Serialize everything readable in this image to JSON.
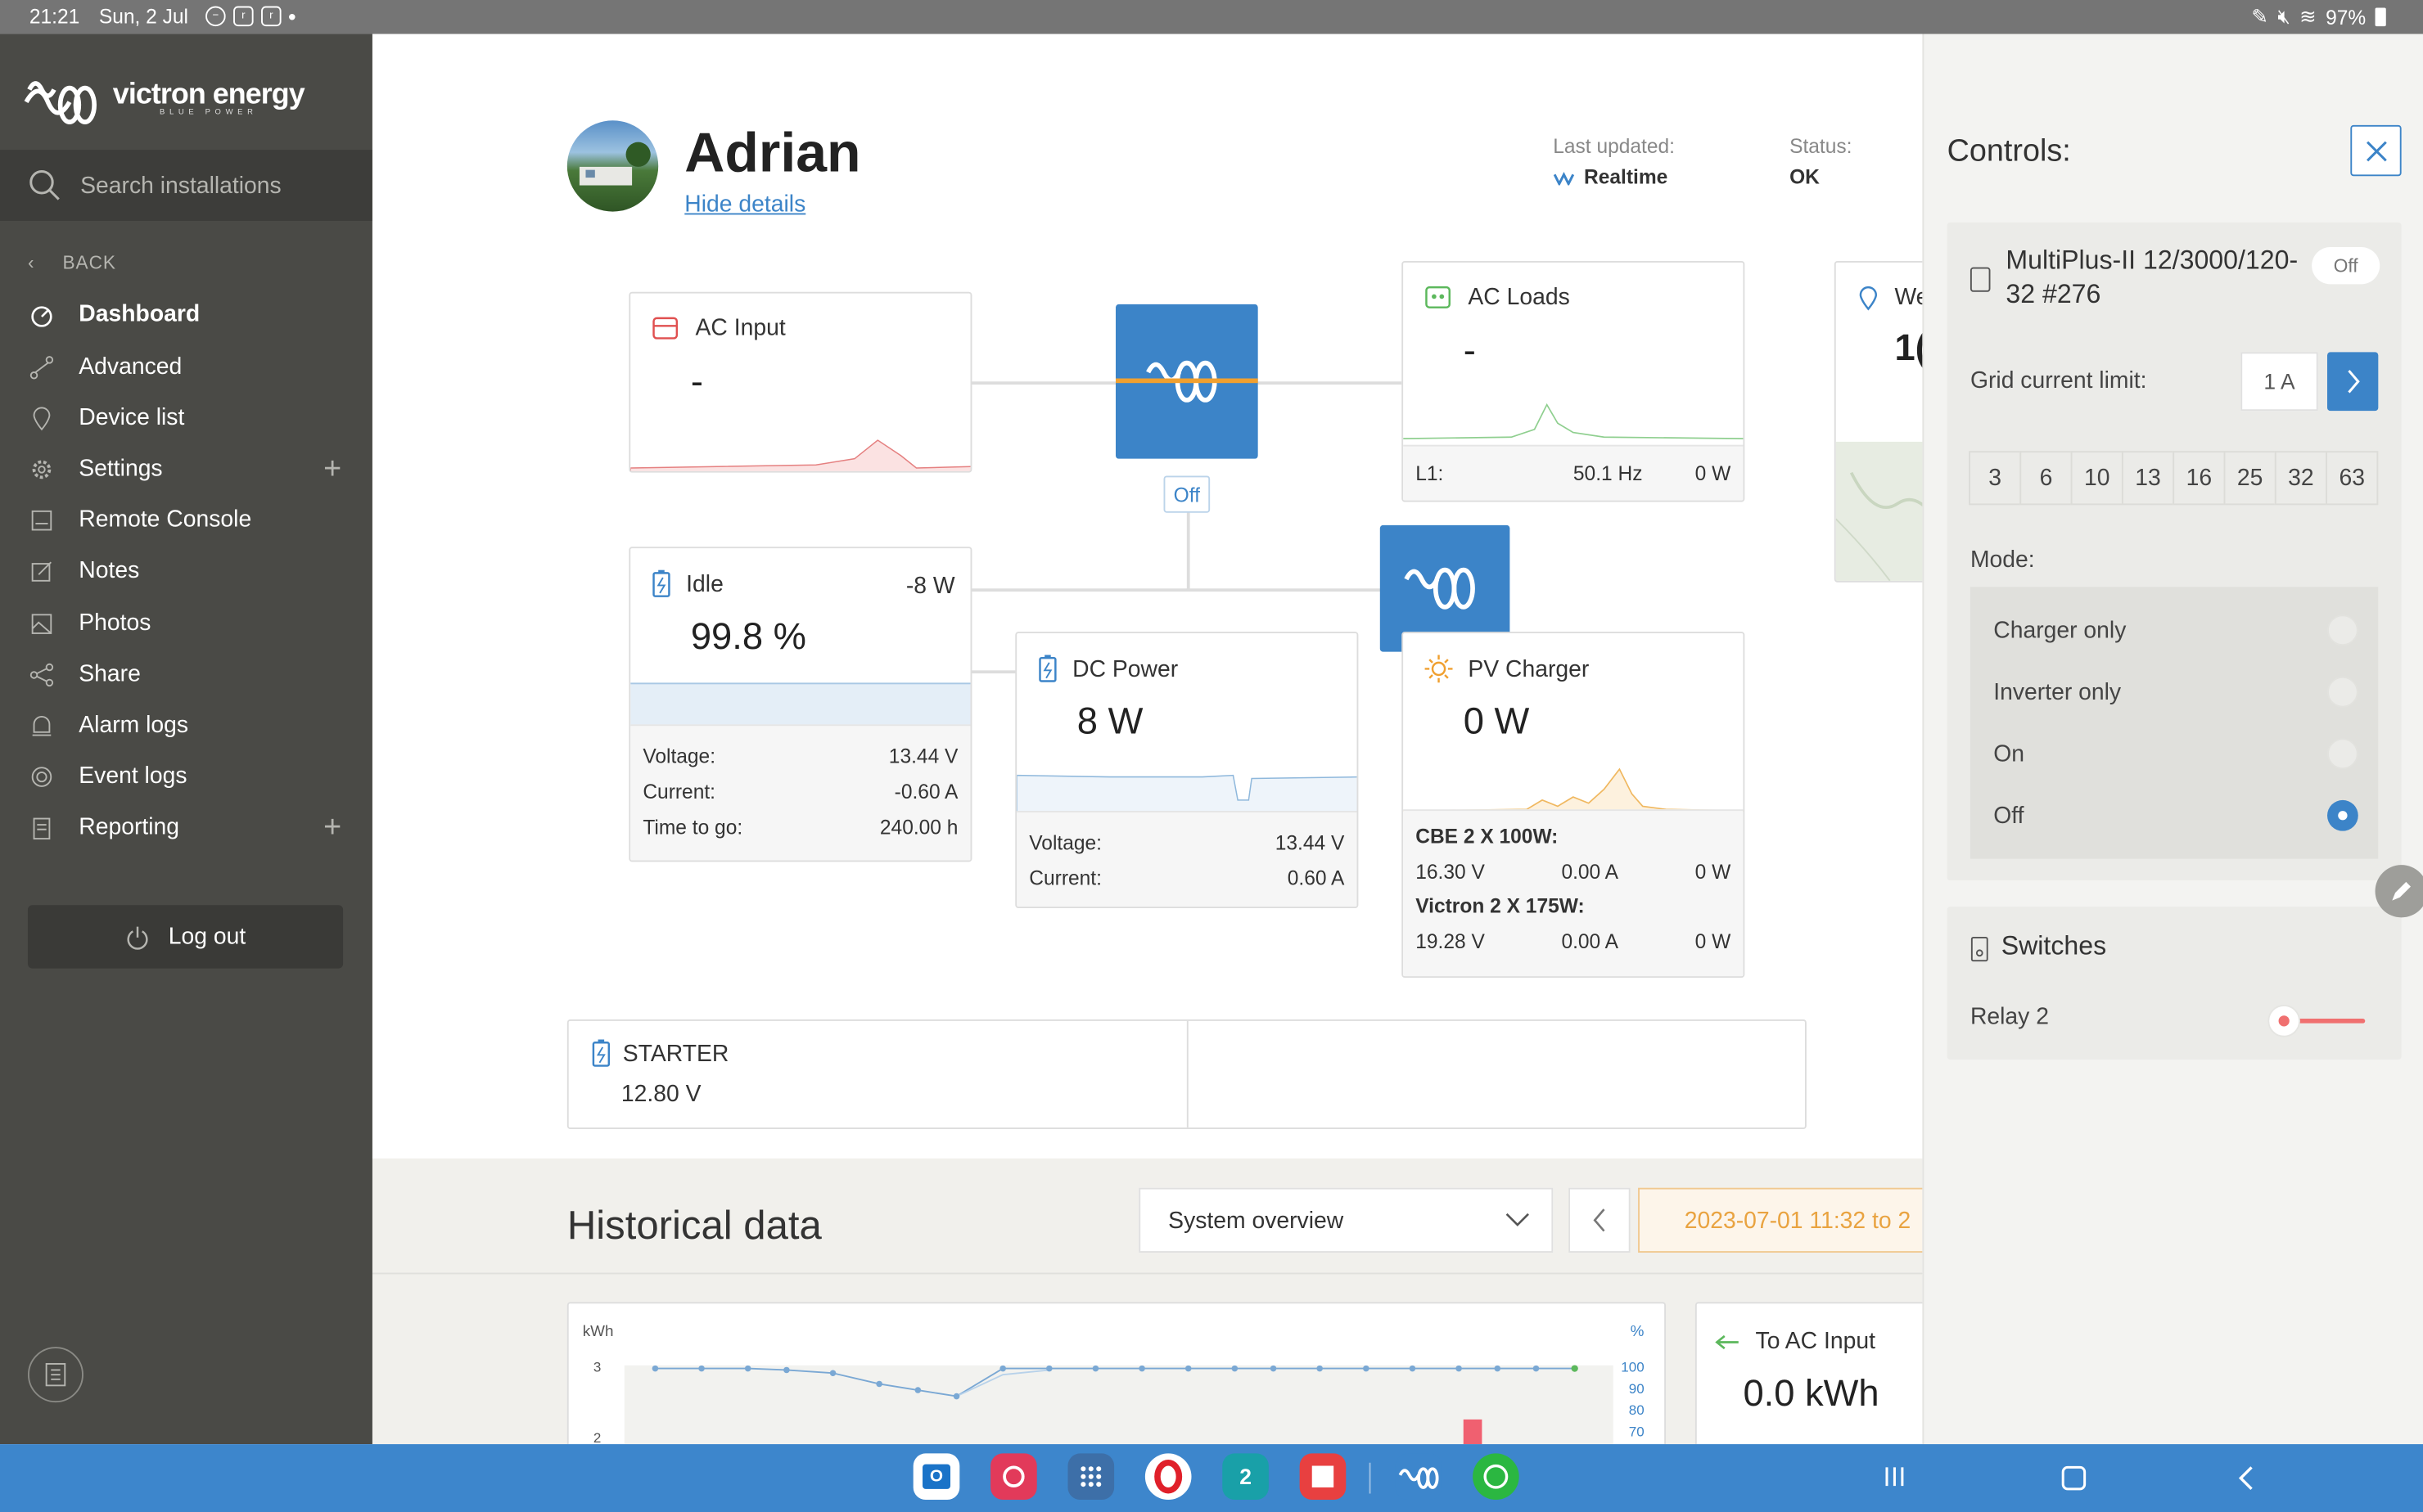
{
  "status_bar": {
    "time": "21:21",
    "date": "Sun, 2 Jul",
    "battery": "97%"
  },
  "sidebar": {
    "brand": "victron energy",
    "brand_sub": "BLUE POWER",
    "search_placeholder": "Search installations",
    "back_label": "BACK",
    "items": [
      {
        "label": "Dashboard",
        "icon": "dashboard-icon"
      },
      {
        "label": "Advanced",
        "icon": "advanced-icon"
      },
      {
        "label": "Device list",
        "icon": "map-pin-icon"
      },
      {
        "label": "Settings",
        "icon": "gear-icon"
      },
      {
        "label": "Remote Console",
        "icon": "console-icon"
      },
      {
        "label": "Notes",
        "icon": "pencil-icon"
      },
      {
        "label": "Photos",
        "icon": "photo-icon"
      },
      {
        "label": "Share",
        "icon": "share-icon"
      },
      {
        "label": "Alarm logs",
        "icon": "alarm-icon"
      },
      {
        "label": "Event logs",
        "icon": "event-icon"
      },
      {
        "label": "Reporting",
        "icon": "report-icon"
      }
    ],
    "logout_label": "Log out"
  },
  "header": {
    "title": "Adrian",
    "hide_details": "Hide details",
    "last_updated_label": "Last updated:",
    "last_updated_value": "Realtime",
    "status_label": "Status:",
    "status_value": "OK"
  },
  "ac_input": {
    "title": "AC Input",
    "value": "-"
  },
  "inverter": {
    "state": "Off"
  },
  "ac_loads": {
    "title": "AC Loads",
    "value": "-",
    "l1_label": "L1:",
    "l1_freq": "50.1 Hz",
    "l1_power": "0 W"
  },
  "weather": {
    "title": "We",
    "value": "1("
  },
  "battery": {
    "title": "Idle",
    "power": "-8 W",
    "soc": "99.8 %",
    "soc_fraction": 0.998,
    "rows": [
      {
        "k": "Voltage:",
        "v": "13.44 V"
      },
      {
        "k": "Current:",
        "v": "-0.60 A"
      },
      {
        "k": "Time to go:",
        "v": "240.00 h"
      }
    ]
  },
  "dc_power": {
    "title": "DC Power",
    "value": "8 W",
    "rows": [
      {
        "k": "Voltage:",
        "v": "13.44 V"
      },
      {
        "k": "Current:",
        "v": "0.60 A"
      }
    ]
  },
  "pv_charger": {
    "title": "PV Charger",
    "value": "0 W",
    "arrays": [
      {
        "name": "CBE 2 X 100W:",
        "voltage": "16.30 V",
        "current": "0.00 A",
        "power": "0 W"
      },
      {
        "name": "Victron 2 X 175W:",
        "voltage": "19.28 V",
        "current": "0.00 A",
        "power": "0 W"
      }
    ]
  },
  "starter": {
    "title": "STARTER",
    "value": "12.80 V"
  },
  "historical": {
    "title": "Historical data",
    "select_value": "System overview",
    "date_range": "2023-07-01 11:32 to 2",
    "to_ac_label": "To AC Input",
    "to_ac_value": "0.0 kWh",
    "chart": {
      "left_unit": "kWh",
      "right_unit": "%",
      "left_ticks": [
        "3",
        "2"
      ],
      "right_ticks": [
        "100",
        "90",
        "80",
        "70"
      ]
    }
  },
  "controls": {
    "title": "Controls:",
    "device_name": "MultiPlus-II 12/3000/120-32 #276",
    "device_state": "Off",
    "grid_limit_label": "Grid current limit:",
    "grid_limit_value": "1 A",
    "amp_options": [
      "3",
      "6",
      "10",
      "13",
      "16",
      "25",
      "32",
      "63"
    ],
    "mode_label": "Mode:",
    "modes": [
      {
        "label": "Charger only",
        "selected": false
      },
      {
        "label": "Inverter only",
        "selected": false
      },
      {
        "label": "On",
        "selected": false
      },
      {
        "label": "Off",
        "selected": true
      }
    ],
    "switches_title": "Switches",
    "relay_label": "Relay 2",
    "relay_on": false
  },
  "colors": {
    "accent": "#3c84c8",
    "sidebar": "#4a4a46",
    "pv": "#f0a030",
    "ac_input": "#e05050",
    "loads": "#5cb85c"
  }
}
